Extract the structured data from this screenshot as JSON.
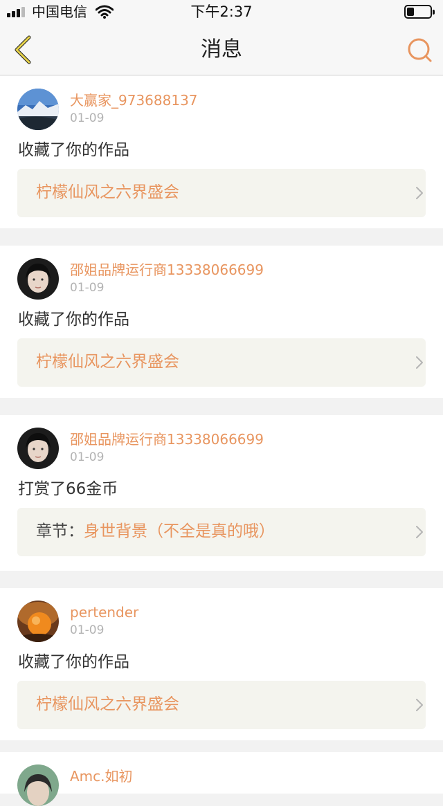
{
  "status_bar": {
    "carrier": "中国电信",
    "time": "下午2:37"
  },
  "nav": {
    "title": "消息",
    "back_icon": "chevron-left-icon",
    "search_icon": "search-icon"
  },
  "colors": {
    "accent": "#e8955f",
    "back_icon": "#e6d24a",
    "link_bg": "#f4f4ee"
  },
  "messages": [
    {
      "username": "大赢家_973688137",
      "date": "01-09",
      "action": "收藏了你的作品",
      "link_prefix": "",
      "link_text": "柠檬仙风之六界盛会"
    },
    {
      "username": "邵姐品牌运行商13338066699",
      "date": "01-09",
      "action": "收藏了你的作品",
      "link_prefix": "",
      "link_text": "柠檬仙风之六界盛会"
    },
    {
      "username": "邵姐品牌运行商13338066699",
      "date": "01-09",
      "action": "打赏了66金币",
      "link_prefix": "章节：",
      "link_text": "身世背景（不全是真的哦）"
    },
    {
      "username": "pertender",
      "date": "01-09",
      "action": "收藏了你的作品",
      "link_prefix": "",
      "link_text": "柠檬仙风之六界盛会"
    },
    {
      "username": "Amc.如初",
      "date": "",
      "action": "",
      "link_prefix": "",
      "link_text": ""
    }
  ]
}
